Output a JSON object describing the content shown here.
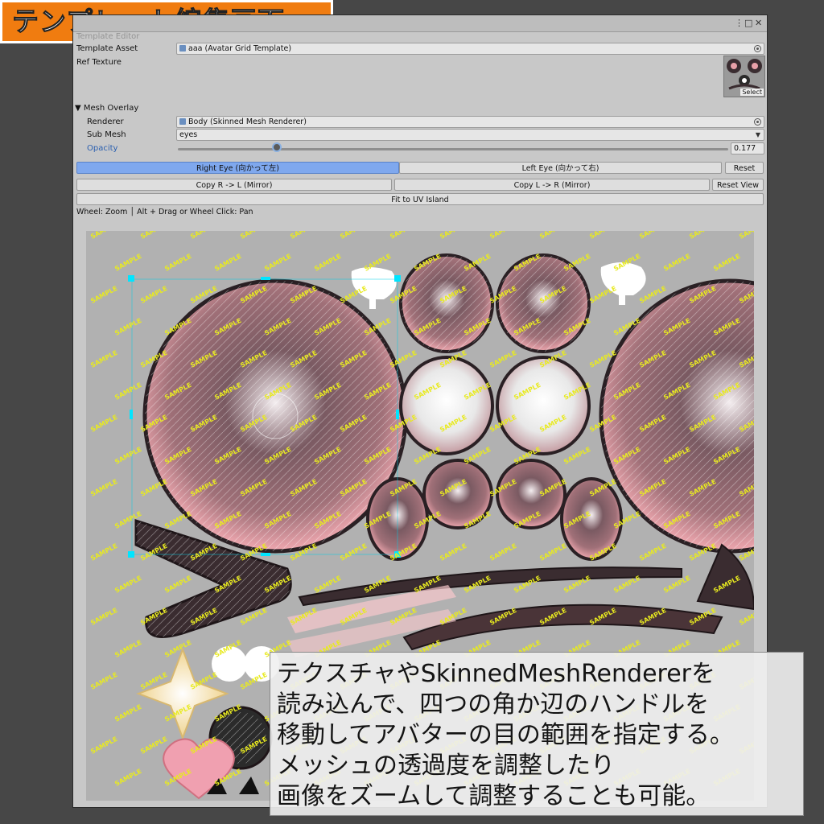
{
  "banner": {
    "text": "テンプレート編集画面"
  },
  "window": {
    "title": "Template Editor",
    "controls": [
      "⋮",
      "□",
      "✕"
    ]
  },
  "fields": {
    "template_asset": {
      "label": "Template Asset",
      "value": "aaa (Avatar Grid Template)"
    },
    "ref_texture": {
      "label": "Ref Texture",
      "select_label": "Select"
    },
    "mesh_overlay": {
      "label": "▼ Mesh Overlay"
    },
    "renderer": {
      "label": "Renderer",
      "value": "Body (Skinned Mesh Renderer)"
    },
    "sub_mesh": {
      "label": "Sub Mesh",
      "value": "eyes"
    },
    "opacity": {
      "label": "Opacity",
      "value": "0.177",
      "fraction": 0.177
    }
  },
  "buttons": {
    "right_eye": "Right Eye (向かって左)",
    "left_eye": "Left Eye (向かって右)",
    "reset": "Reset",
    "copy_r_l": "Copy R -> L (Mirror)",
    "copy_l_r": "Copy L -> R (Mirror)",
    "reset_view": "Reset View",
    "fit_uv": "Fit to UV Island"
  },
  "hint": "Wheel: Zoom │ Alt + Drag or Wheel Click: Pan",
  "watermark": "SAMPLE",
  "description": {
    "lines": [
      "テクスチャやSkinnedMeshRendererを",
      "読み込んで、四つの角か辺のハンドルを",
      "移動してアバターの目の範囲を指定する。",
      "メッシュの透過度を調整したり",
      "画像をズームして調整することも可能。"
    ]
  },
  "colors": {
    "accent": "#f07c10",
    "active_tab": "#7fa8ee",
    "handle": "#00e5ff",
    "iris_dark": "#3a2c30",
    "iris_pink": "#e8a0a8"
  }
}
